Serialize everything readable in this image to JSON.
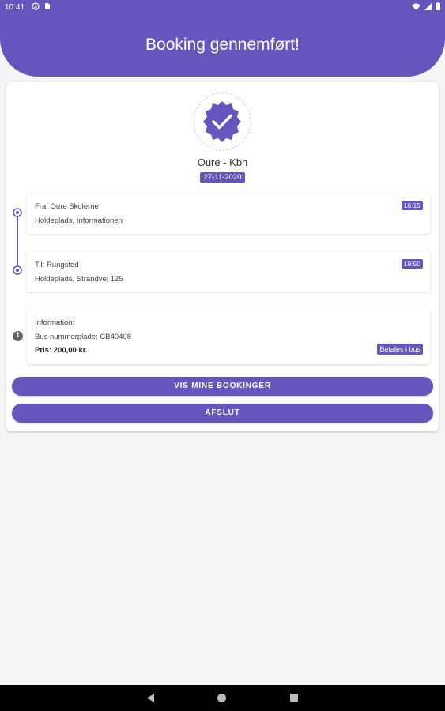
{
  "status_bar": {
    "time": "10:41",
    "left_icons": [
      "notification-icon",
      "sim-icon"
    ],
    "right_icons": [
      "wifi-icon",
      "signal-icon",
      "battery-icon"
    ]
  },
  "header": {
    "title": "Booking gennemført!"
  },
  "booking": {
    "route": "Oure - Kbh",
    "date": "27-11-2020",
    "departure": {
      "label": "Fra: Oure Skolerne",
      "stop": "Holdeplads, Informationen",
      "time": "16:15"
    },
    "arrival": {
      "label": "Til: Rungsted",
      "stop": "Holdeplads, Strandvej 125",
      "time": "19:50"
    },
    "info": {
      "heading": "Information:",
      "plate": "Bus nummerplade: CB40408",
      "price": "Pris: 200,00 kr.",
      "payment": "Betales i bus"
    }
  },
  "actions": {
    "my_bookings": "VIS MINE BOOKINGER",
    "finish": "AFSLUT"
  },
  "colors": {
    "primary": "#6655bd",
    "background": "#f5f5f5"
  }
}
